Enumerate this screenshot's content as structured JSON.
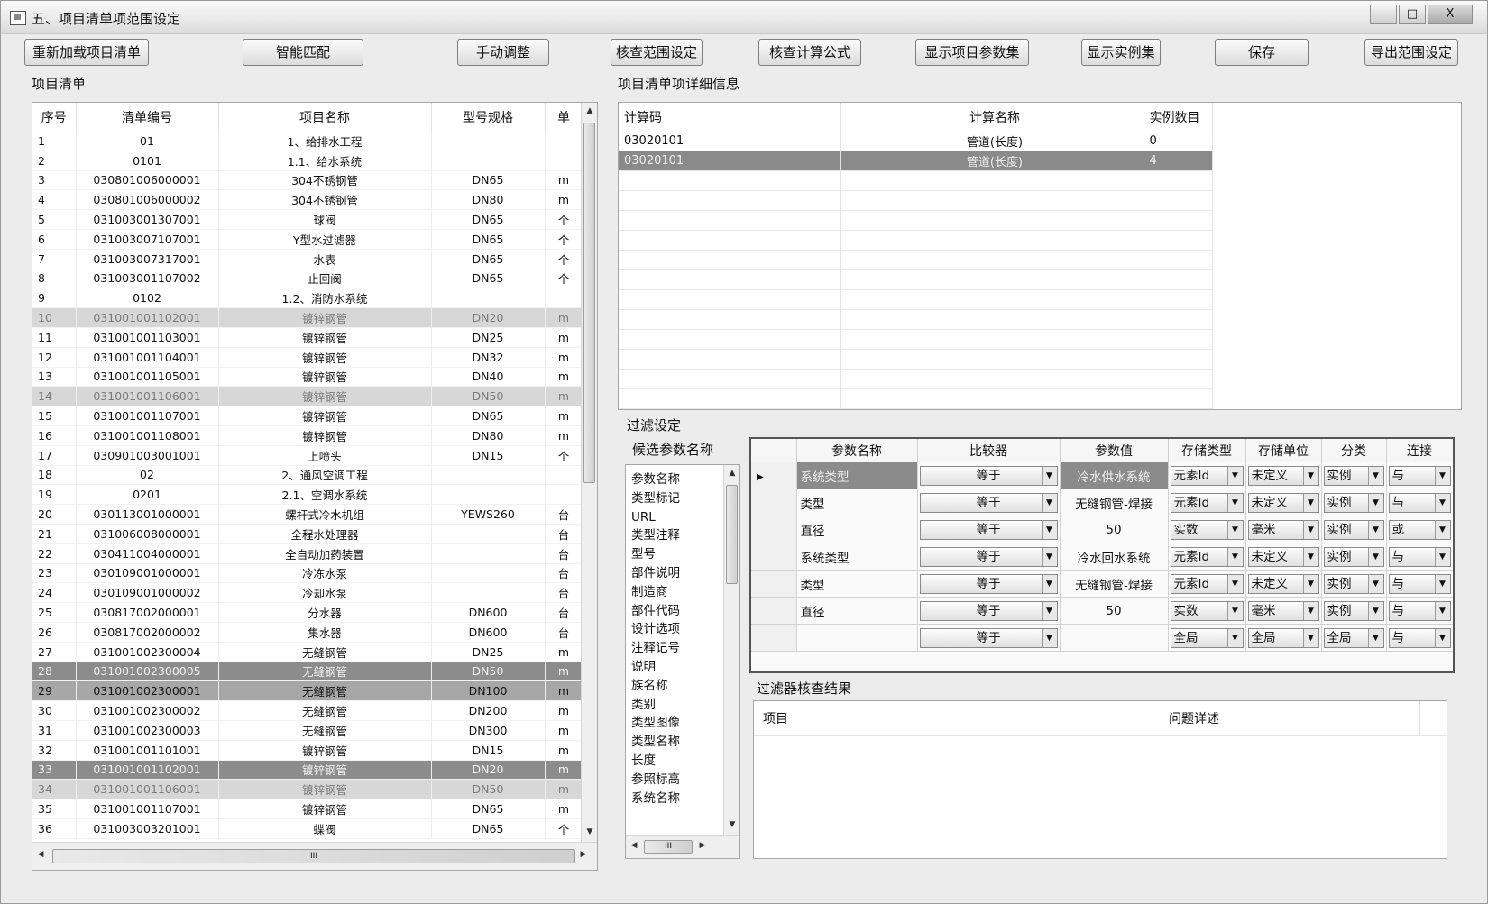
{
  "window": {
    "title": "五、项目清单项范围设定",
    "minimize": "—",
    "maximize": "□",
    "close": "X"
  },
  "toolbar": [
    "重新加载项目清单",
    "智能匹配",
    "手动调整",
    "核查范围设定",
    "核查计算公式",
    "显示项目参数集",
    "显示实例集",
    "保存",
    "导出范围设定"
  ],
  "left": {
    "label": "项目清单",
    "columns": [
      "序号",
      "清单编号",
      "项目名称",
      "型号规格",
      "单"
    ],
    "rows": [
      [
        "1",
        "01",
        "1、给排水工程",
        "",
        ""
      ],
      [
        "2",
        "0101",
        "1.1、给水系统",
        "",
        ""
      ],
      [
        "3",
        "030801006000001",
        "304不锈钢管",
        "DN65",
        "m"
      ],
      [
        "4",
        "030801006000002",
        "304不锈钢管",
        "DN80",
        "m"
      ],
      [
        "5",
        "031003001307001",
        "球阀",
        "DN65",
        "个"
      ],
      [
        "6",
        "031003007107001",
        "Y型水过滤器",
        "DN65",
        "个"
      ],
      [
        "7",
        "031003007317001",
        "水表",
        "DN65",
        "个"
      ],
      [
        "8",
        "031003001107002",
        "止回阀",
        "DN65",
        "个"
      ],
      [
        "9",
        "0102",
        "1.2、消防水系统",
        "",
        ""
      ],
      [
        "10",
        "031001001102001",
        "镀锌钢管",
        "DN20",
        "m"
      ],
      [
        "11",
        "031001001103001",
        "镀锌钢管",
        "DN25",
        "m"
      ],
      [
        "12",
        "031001001104001",
        "镀锌钢管",
        "DN32",
        "m"
      ],
      [
        "13",
        "031001001105001",
        "镀锌钢管",
        "DN40",
        "m"
      ],
      [
        "14",
        "031001001106001",
        "镀锌钢管",
        "DN50",
        "m"
      ],
      [
        "15",
        "031001001107001",
        "镀锌钢管",
        "DN65",
        "m"
      ],
      [
        "16",
        "031001001108001",
        "镀锌钢管",
        "DN80",
        "m"
      ],
      [
        "17",
        "030901003001001",
        "上喷头",
        "DN15",
        "个"
      ],
      [
        "18",
        "02",
        "2、通风空调工程",
        "",
        ""
      ],
      [
        "19",
        "0201",
        "2.1、空调水系统",
        "",
        ""
      ],
      [
        "20",
        "030113001000001",
        "螺杆式冷水机组",
        "YEWS260",
        "台"
      ],
      [
        "21",
        "031006008000001",
        "全程水处理器",
        "",
        "台"
      ],
      [
        "22",
        "030411004000001",
        "全自动加药装置",
        "",
        "台"
      ],
      [
        "23",
        "030109001000001",
        "冷冻水泵",
        "",
        "台"
      ],
      [
        "24",
        "030109001000002",
        "冷却水泵",
        "",
        "台"
      ],
      [
        "25",
        "030817002000001",
        "分水器",
        "DN600",
        "台"
      ],
      [
        "26",
        "030817002000002",
        "集水器",
        "DN600",
        "台"
      ],
      [
        "27",
        "031001002300004",
        "无缝钢管",
        "DN25",
        "m"
      ],
      [
        "28",
        "031001002300005",
        "无缝钢管",
        "DN50",
        "m"
      ],
      [
        "29",
        "031001002300001",
        "无缝钢管",
        "DN100",
        "m"
      ],
      [
        "30",
        "031001002300002",
        "无缝钢管",
        "DN200",
        "m"
      ],
      [
        "31",
        "031001002300003",
        "无缝钢管",
        "DN300",
        "m"
      ],
      [
        "32",
        "031001001101001",
        "镀锌钢管",
        "DN15",
        "m"
      ],
      [
        "33",
        "031001001102001",
        "镀锌钢管",
        "DN20",
        "m"
      ],
      [
        "34",
        "031001001106001",
        "镀锌钢管",
        "DN50",
        "m"
      ],
      [
        "35",
        "031001001107001",
        "镀锌钢管",
        "DN65",
        "m"
      ],
      [
        "36",
        "031003003201001",
        "蝶阀",
        "DN65",
        "个"
      ]
    ],
    "hscroll_grip": "III"
  },
  "detail": {
    "label": "项目清单项详细信息",
    "columns": [
      "计算码",
      "计算名称",
      "实例数目"
    ],
    "rows": [
      [
        "03020101",
        "管道(长度)",
        "0"
      ],
      [
        "03020101",
        "管道(长度)",
        "4"
      ]
    ]
  },
  "filter": {
    "label": "过滤设定",
    "candidate_label": "候选参数名称",
    "candidates": [
      "参数名称",
      "类型标记",
      "URL",
      "类型注释",
      "型号",
      "部件说明",
      "制造商",
      "部件代码",
      "设计选项",
      "注释记号",
      "说明",
      "族名称",
      "类别",
      "类型图像",
      "类型名称",
      "长度",
      "参照标高",
      "系统名称"
    ],
    "cand_hscroll_grip": "III",
    "columns": [
      "参数名称",
      "比较器",
      "参数值",
      "存储类型",
      "存储单位",
      "分类",
      "连接"
    ],
    "rows": [
      [
        "系统类型",
        "等于",
        "冷水供水系统",
        "元素Id",
        "未定义",
        "实例",
        "与"
      ],
      [
        "类型",
        "等于",
        "无缝钢管-焊接",
        "元素Id",
        "未定义",
        "实例",
        "与"
      ],
      [
        "直径",
        "等于",
        "50",
        "实数",
        "毫米",
        "实例",
        "或"
      ],
      [
        "系统类型",
        "等于",
        "冷水回水系统",
        "元素Id",
        "未定义",
        "实例",
        "与"
      ],
      [
        "类型",
        "等于",
        "无缝钢管-焊接",
        "元素Id",
        "未定义",
        "实例",
        "与"
      ],
      [
        "直径",
        "等于",
        "50",
        "实数",
        "毫米",
        "实例",
        "与"
      ],
      [
        "",
        "等于",
        "",
        "全局",
        "全局",
        "全局",
        "与"
      ]
    ]
  },
  "result": {
    "label": "过滤器核查结果",
    "columns": [
      "项目",
      "问题详述"
    ]
  }
}
